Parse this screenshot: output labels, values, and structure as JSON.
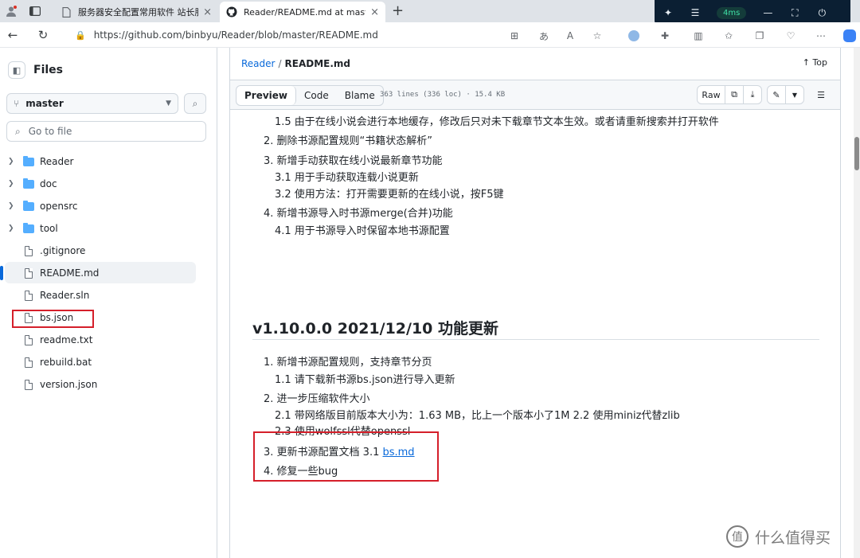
{
  "browser": {
    "tabs": [
      {
        "title": "服务器安全配置常用软件 站长服",
        "close": "×"
      },
      {
        "title": "Reader/README.md at master · b",
        "close": "×"
      }
    ],
    "new_tab": "+",
    "latency": "4ms",
    "url": "https://github.com/binbyu/Reader/blob/master/README.md"
  },
  "sidebar": {
    "title": "Files",
    "branch": "master",
    "goto_placeholder": "Go to file",
    "items": [
      {
        "name": "Reader",
        "type": "folder"
      },
      {
        "name": "doc",
        "type": "folder"
      },
      {
        "name": "opensrc",
        "type": "folder"
      },
      {
        "name": "tool",
        "type": "folder"
      },
      {
        "name": ".gitignore",
        "type": "file"
      },
      {
        "name": "README.md",
        "type": "file",
        "selected": true
      },
      {
        "name": "Reader.sln",
        "type": "file"
      },
      {
        "name": "bs.json",
        "type": "file"
      },
      {
        "name": "readme.txt",
        "type": "file"
      },
      {
        "name": "rebuild.bat",
        "type": "file"
      },
      {
        "name": "version.json",
        "type": "file"
      }
    ]
  },
  "main": {
    "breadcrumb_repo": "Reader",
    "breadcrumb_sep": "/",
    "breadcrumb_file": "README.md",
    "top_link": "Top",
    "tabs": {
      "preview": "Preview",
      "code": "Code",
      "blame": "Blame"
    },
    "meta": "363 lines (336 loc) · 15.4 KB",
    "raw_label": "Raw",
    "lines": [
      "1.5 由于在线小说会进行本地缓存，修改后只对未下载章节文本生效。或者请重新搜索并打开软件",
      "2. 删除书源配置规则“书籍状态解析”",
      "3. 新增手动获取在线小说最新章节功能",
      "3.1 用于手动获取连载小说更新",
      "3.2 使用方法：打开需要更新的在线小说，按F5键",
      "4. 新增书源导入时书源merge(合并)功能",
      "4.1 用于书源导入时保留本地书源配置"
    ],
    "heading": "v1.10.0.0 2021/12/10 功能更新",
    "lines2": [
      "1. 新增书源配置规则，支持章节分页",
      "1.1 请下载新书源bs.json进行导入更新",
      "2. 进一步压缩软件大小",
      "2.1 带网络版目前版本大小为：1.63 MB，比上一个版本小了1M 2.2 使用miniz代替zlib",
      "2.3 使用wolfssl代替openssl"
    ],
    "line3_prefix": "3. 更新书源配置文档 3.1 ",
    "line3_link": "bs.md",
    "line4": "4. 修复一些bug"
  },
  "watermark": {
    "text": "什么值得买",
    "logo": "值"
  },
  "colors": {
    "accent": "#0969da",
    "highlight": "#d51f2a",
    "folder": "#54aeff"
  }
}
